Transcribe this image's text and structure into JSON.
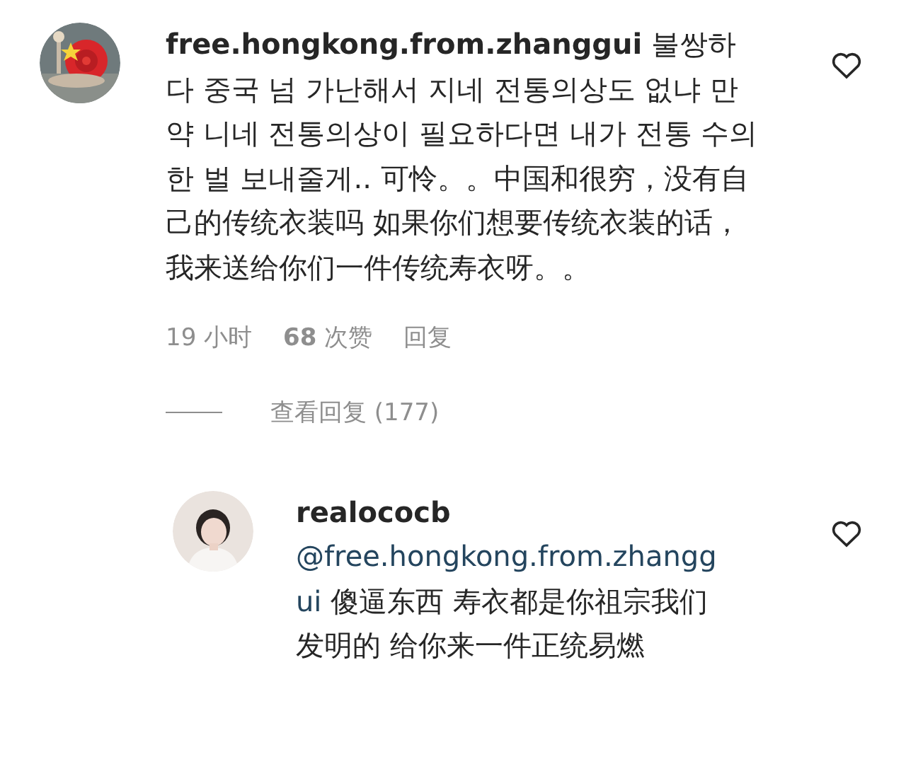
{
  "comments": [
    {
      "username": "free.hongkong.from.zhanggui",
      "text": "불쌍하다 중국 넘 가난해서 지네 전통의상도 없냐 만약 니네 전통의상이 필요하다면 내가 전통 수의 한 벌 보내줄게.. 可怜。。中国和很穷，没有自己的传统衣装吗 如果你们想要传统衣装的话，我来送给你们一件传统寿衣呀。。",
      "time": "19 小时",
      "likes": "68 次赞",
      "reply": "回复",
      "view_replies": "查看回复 (177)"
    },
    {
      "username": "realococb",
      "mention": "@free.hongkong.from.zhanggui",
      "text": "傻逼东西 寿衣都是你祖宗我们发明的 给你来一件正统易燃"
    }
  ]
}
